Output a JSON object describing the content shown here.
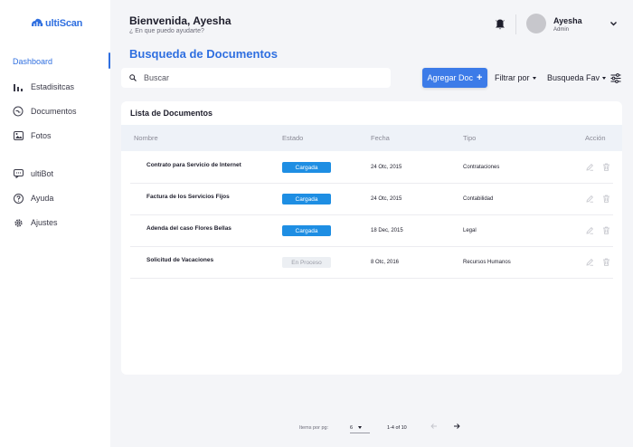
{
  "brand": {
    "logo_text": "ultiScan",
    "accent": "#2f6fe0"
  },
  "sidebar": {
    "items": [
      {
        "label": "Dashboard",
        "icon": "none",
        "active": true
      },
      {
        "label": "Estadisitcas",
        "icon": "bar-chart-icon"
      },
      {
        "label": "Documentos",
        "icon": "document-icon"
      },
      {
        "label": "Fotos",
        "icon": "image-icon"
      },
      {
        "label": "ultiBot",
        "icon": "chat-icon"
      },
      {
        "label": "Ayuda",
        "icon": "help-icon"
      },
      {
        "label": "Ajustes",
        "icon": "gear-icon"
      }
    ]
  },
  "header": {
    "greeting": "Bienvenida, Ayesha",
    "subtitle": "¿ En que puedo ayudarte?",
    "user_name": "Ayesha",
    "user_role": "Admin"
  },
  "page": {
    "title": "Busqueda de Documentos"
  },
  "toolbar": {
    "search_placeholder": "Buscar",
    "add_label": "Agregar Doc",
    "add_icon": "+",
    "filter_label": "Filtrar por",
    "favorites_label": "Busqueda Fav"
  },
  "table": {
    "title": "Lista de Documentos",
    "columns": [
      "Nombre",
      "Estado",
      "Fecha",
      "Tipo",
      "Acción"
    ],
    "rows": [
      {
        "name": "Contrato para Servicio de Internet",
        "status": "Cargada",
        "status_kind": "blue",
        "date": "24 Otc, 2015",
        "type": "Contrataciones"
      },
      {
        "name": "Factura de los Servicios Fijos",
        "status": "Cargada",
        "status_kind": "blue",
        "date": "24 Otc, 2015",
        "type": "Contabilidad"
      },
      {
        "name": "Adenda del caso Flores Bellas",
        "status": "Cargada",
        "status_kind": "blue",
        "date": "18 Dec, 2015",
        "type": "Legal"
      },
      {
        "name": "Solicitud de Vacaciones",
        "status": "En Proceso",
        "status_kind": "grey",
        "date": "8 Otc, 2016",
        "type": "Recursos Humanos"
      }
    ]
  },
  "pagination": {
    "items_label": "Items por pg:",
    "per_page": "6",
    "range": "1-4 of 10"
  }
}
